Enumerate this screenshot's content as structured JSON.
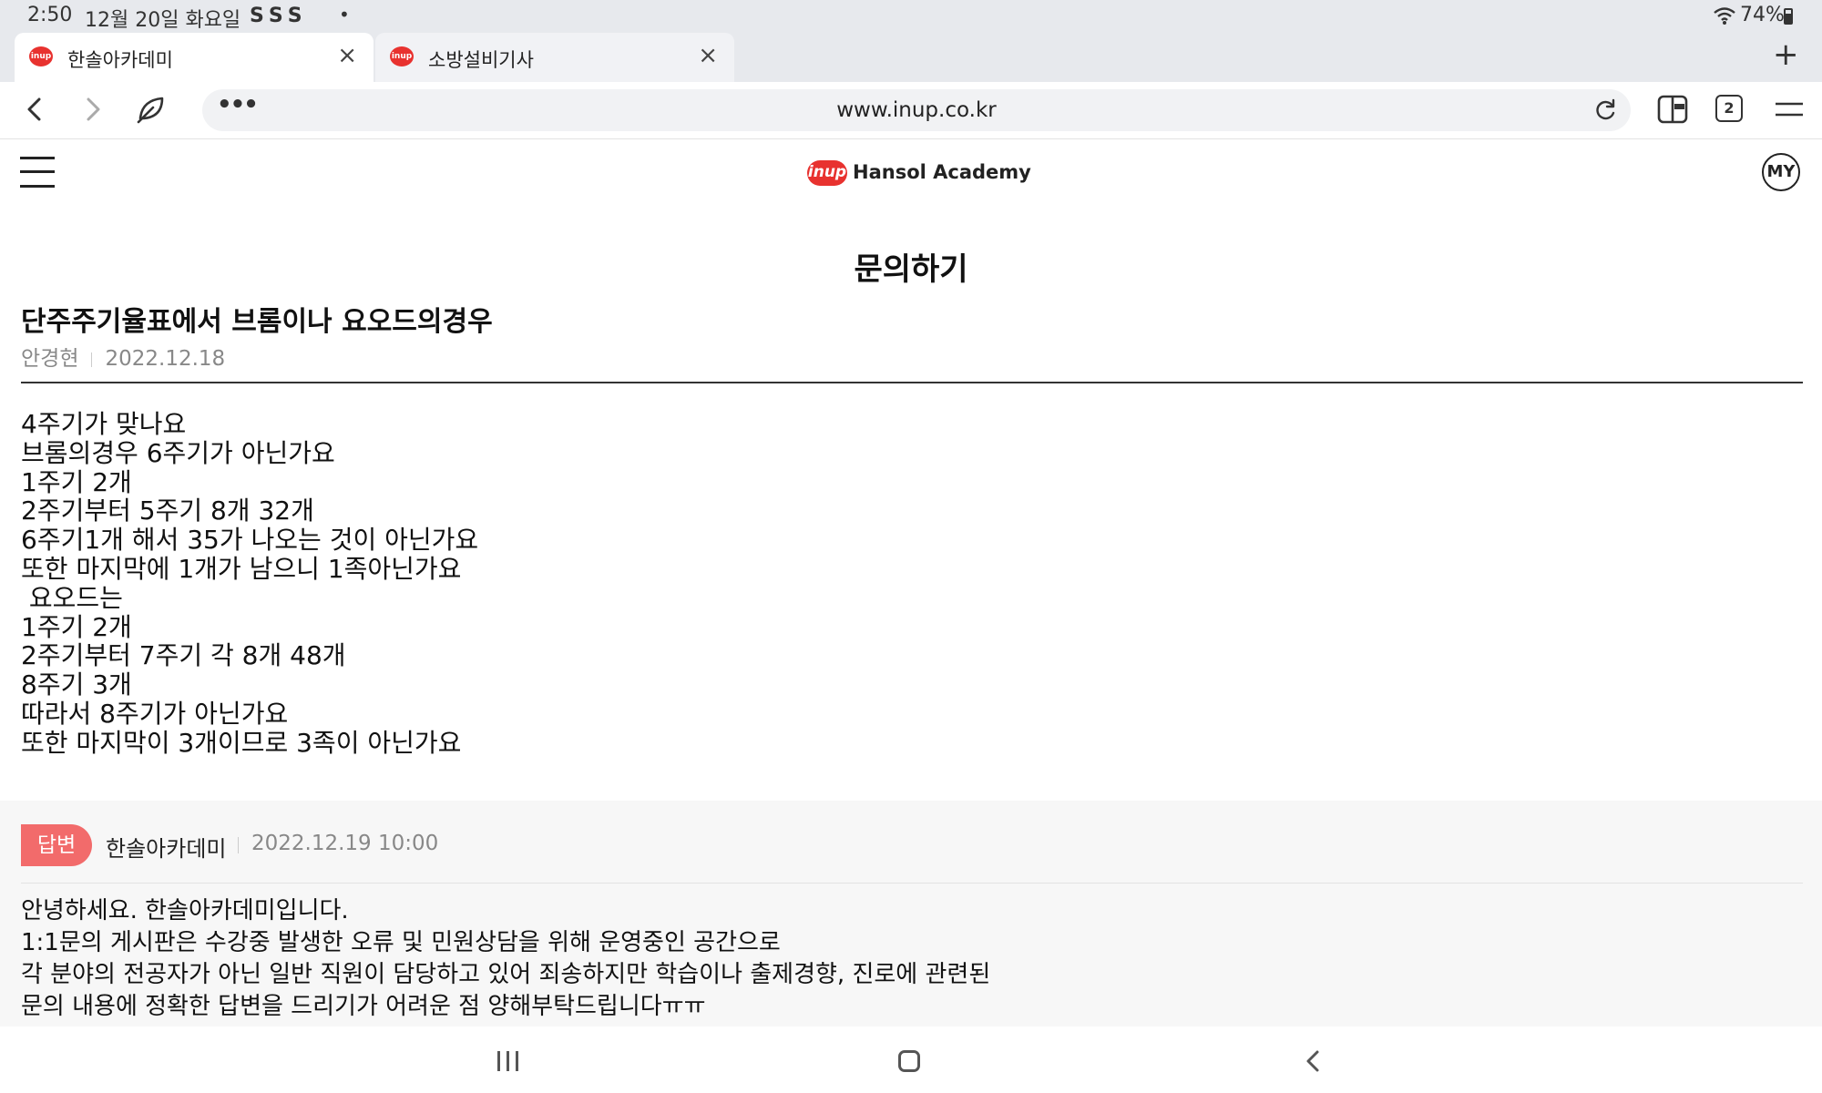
{
  "status_bar": {
    "time": "2:50",
    "date": "12월 20일 화요일",
    "notification_icons": "SSS",
    "dot": "•",
    "battery": "74%"
  },
  "tabs": [
    {
      "favicon": "inup",
      "title": "한솔아카데미",
      "close": "×"
    },
    {
      "favicon": "inup",
      "title": "소방설비기사",
      "close": "×"
    }
  ],
  "tab_new": "+",
  "address_bar": {
    "more": "•••",
    "url": "www.inup.co.kr",
    "tab_count": "2"
  },
  "site_header": {
    "logo_mark": "inup",
    "logo_text": "Hansol Academy",
    "my_button": "MY"
  },
  "page": {
    "title": "문의하기"
  },
  "question": {
    "title": "단주주기율표에서 브롬이나 요오드의경우",
    "author": "안경현",
    "date": "2022.12.18",
    "body": "4주기가 맞나요\n브롬의경우 6주기가 아닌가요\n1주기 2개\n2주기부터 5주기 8개 32개\n6주기1개 해서 35가 나오는 것이 아닌가요\n또한 마지막에 1개가 남으니 1족아닌가요\n 요오드는\n1주기 2개\n2주기부터 7주기 각 8개 48개\n8주기 3개\n따라서 8주기가 아닌가요\n또한 마지막이 3개이므로 3족이 아닌가요"
  },
  "answer": {
    "badge": "답변",
    "author": "한솔아카데미",
    "date": "2022.12.19 10:00",
    "body": "안녕하세요. 한솔아카데미입니다.\n1:1문의 게시판은 수강중 발생한 오류 및 민원상담을 위해 운영중인 공간으로\n각 분야의 전공자가 아닌 일반 직원이 담당하고 있어 죄송하지만 학습이나 출제경향, 진로에 관련된\n문의 내용에 정확한 답변을 드리기가 어려운 점 양해부탁드립니다ㅠㅠ"
  },
  "colors": {
    "brand_red": "#e8322f",
    "answer_badge": "#f26b6b",
    "chrome_bg": "#e7e9ed"
  }
}
